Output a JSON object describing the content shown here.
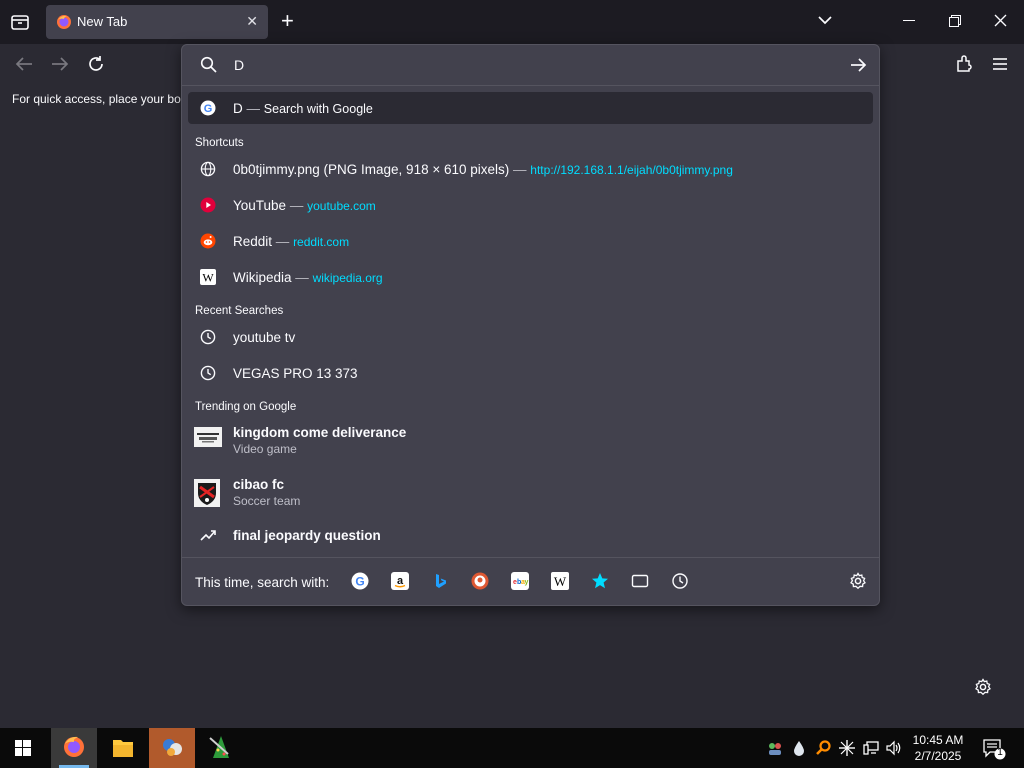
{
  "tab": {
    "title": "New Tab"
  },
  "bookmarks_bar": {
    "text": "For quick access, place your boo"
  },
  "urlbar": {
    "value": "D"
  },
  "heuristic": {
    "query": "D",
    "separator": "—",
    "action": "Search with Google"
  },
  "groups": {
    "shortcuts": "Shortcuts",
    "recent": "Recent Searches",
    "trending": "Trending on Google"
  },
  "shortcuts": [
    {
      "title": "0b0tjimmy.png (PNG Image, 918 × 610 pixels)",
      "url": "http://192.168.1.1/eijah/0b0tjimmy.png",
      "icon": "globe-icon"
    },
    {
      "title": "YouTube",
      "url": "youtube.com",
      "icon": "youtube-icon"
    },
    {
      "title": "Reddit",
      "url": "reddit.com",
      "icon": "reddit-icon"
    },
    {
      "title": "Wikipedia",
      "url": "wikipedia.org",
      "icon": "wikipedia-icon"
    }
  ],
  "recent": [
    {
      "text": "youtube tv",
      "icon": "history-icon"
    },
    {
      "text": "VEGAS PRO 13 373",
      "icon": "history-icon"
    }
  ],
  "trending": [
    {
      "title": "kingdom come deliverance",
      "subtitle": "Video game"
    },
    {
      "title": "cibao fc",
      "subtitle": "Soccer team"
    },
    {
      "title": "final jeopardy question",
      "subtitle": ""
    }
  ],
  "footer": {
    "label": "This time, search with:",
    "engines": [
      "google-icon",
      "amazon-icon",
      "bing-icon",
      "duckduckgo-icon",
      "ebay-icon",
      "wikipedia-icon",
      "bookmarks-star-icon",
      "tabs-icon",
      "history-icon"
    ]
  },
  "clock": {
    "time": "10:45 AM",
    "date": "2/7/2025"
  },
  "notifications": {
    "count": "1"
  },
  "colors": {
    "accent_url": "#00ddff",
    "popup_bg": "#42414d",
    "page_bg": "#2b2a33",
    "tabstrip_bg": "#1c1b22"
  }
}
